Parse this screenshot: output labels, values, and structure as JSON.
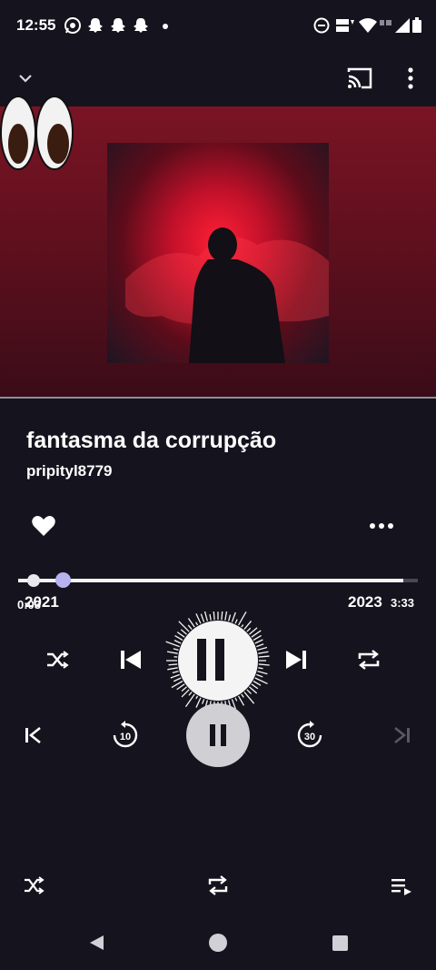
{
  "status_bar": {
    "time": "12:55"
  },
  "song": {
    "title": "fantasma da corrupção",
    "artist": "pripityl8779"
  },
  "progress": {
    "elapsed_overlay": "2021",
    "duration_overlay": "2023",
    "elapsed_small": "0:03",
    "duration_small": "3:33",
    "fraction": 0.03
  },
  "colors": {
    "background": "#15131d",
    "accent_knob": "#b7b2f0",
    "art_red": "#c2112a"
  },
  "icons": [
    "whatsapp-icon",
    "snapchat-icon",
    "dnd-icon",
    "volte-icon",
    "wifi-icon",
    "signal-icon",
    "battery-icon",
    "chevron-down-icon",
    "cast-icon",
    "more-vert-icon",
    "heart-icon",
    "more-horiz-icon",
    "shuffle-icon",
    "previous-icon",
    "pause-icon",
    "next-icon",
    "repeat-icon",
    "skip-start-icon",
    "rewind-10-icon",
    "forward-30-icon",
    "skip-end-icon",
    "queue-icon",
    "back-icon",
    "home-icon",
    "recents-icon"
  ]
}
